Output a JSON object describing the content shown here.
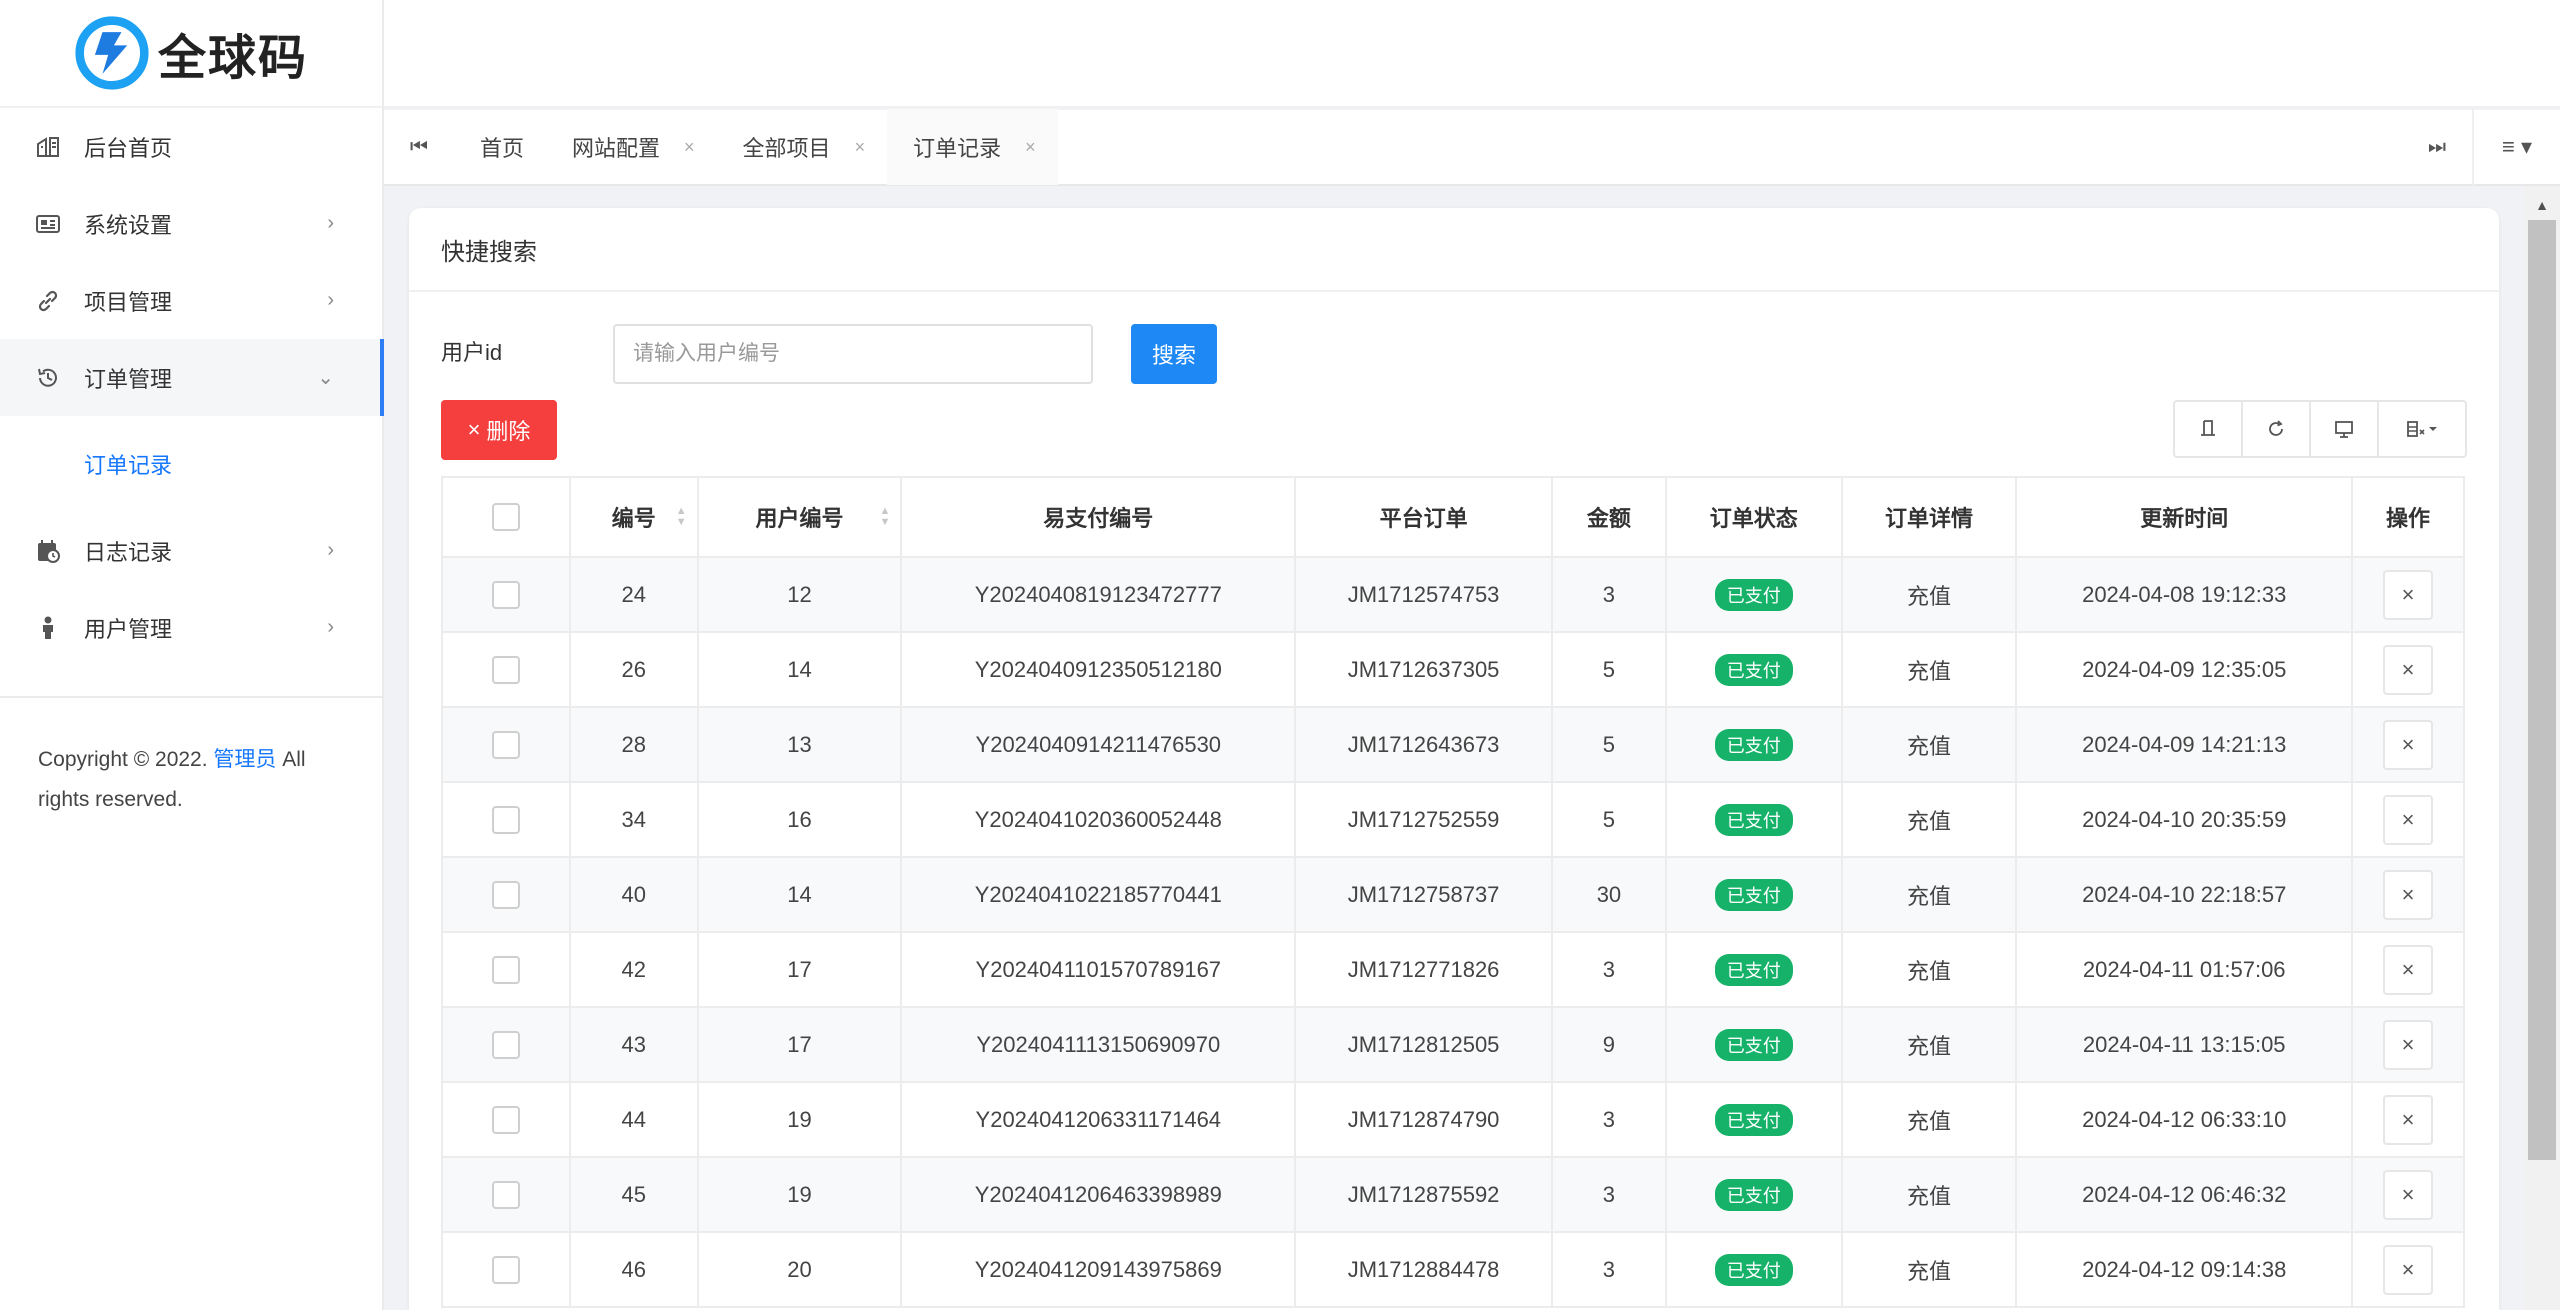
{
  "brand": {
    "name": "全球码",
    "accent": "#1677ff",
    "logo_colors": [
      "#1da1f2",
      "#1e7be0"
    ]
  },
  "sidebar": {
    "items": [
      {
        "label": "后台首页",
        "icon": "dashboard-icon",
        "has_arrow": false
      },
      {
        "label": "系统设置",
        "icon": "settings-card-icon",
        "has_arrow": true,
        "arrow": "›"
      },
      {
        "label": "项目管理",
        "icon": "link-icon",
        "has_arrow": true,
        "arrow": "›"
      },
      {
        "label": "订单管理",
        "icon": "history-icon",
        "has_arrow": true,
        "arrow": "⌄",
        "open": true
      },
      {
        "label": "日志记录",
        "icon": "calendar-check-icon",
        "has_arrow": true,
        "arrow": "›"
      },
      {
        "label": "用户管理",
        "icon": "person-icon",
        "has_arrow": true,
        "arrow": "›"
      }
    ],
    "submenu": {
      "label": "订单记录"
    },
    "copyright": {
      "prefix": "Copyright © 2022. ",
      "link": "管理员",
      "suffix_1": " All",
      "suffix_2": "rights reserved."
    }
  },
  "tabs": [
    {
      "label": "首页",
      "closable": false
    },
    {
      "label": "网站配置",
      "closable": true
    },
    {
      "label": "全部项目",
      "closable": true
    },
    {
      "label": "订单记录",
      "closable": true,
      "active": true
    }
  ],
  "tab_close_glyph": "×",
  "card": {
    "title": "快捷搜索",
    "search_label": "用户id",
    "search_placeholder": "请输入用户编号",
    "search_button": "搜索",
    "delete_button": "删除",
    "delete_glyph": "×"
  },
  "table": {
    "columns": [
      "编号",
      "用户编号",
      "易支付编号",
      "平台订单",
      "金额",
      "订单状态",
      "订单详情",
      "更新时间",
      "操作"
    ],
    "status_color": "#17b26a",
    "rows": [
      {
        "id": "24",
        "user": "12",
        "pay_no": "Y2024040819123472777",
        "order": "JM1712574753",
        "amount": "3",
        "status": "已支付",
        "detail": "充值",
        "time": "2024-04-08 19:12:33"
      },
      {
        "id": "26",
        "user": "14",
        "pay_no": "Y2024040912350512180",
        "order": "JM1712637305",
        "amount": "5",
        "status": "已支付",
        "detail": "充值",
        "time": "2024-04-09 12:35:05"
      },
      {
        "id": "28",
        "user": "13",
        "pay_no": "Y2024040914211476530",
        "order": "JM1712643673",
        "amount": "5",
        "status": "已支付",
        "detail": "充值",
        "time": "2024-04-09 14:21:13"
      },
      {
        "id": "34",
        "user": "16",
        "pay_no": "Y2024041020360052448",
        "order": "JM1712752559",
        "amount": "5",
        "status": "已支付",
        "detail": "充值",
        "time": "2024-04-10 20:35:59"
      },
      {
        "id": "40",
        "user": "14",
        "pay_no": "Y2024041022185770441",
        "order": "JM1712758737",
        "amount": "30",
        "status": "已支付",
        "detail": "充值",
        "time": "2024-04-10 22:18:57"
      },
      {
        "id": "42",
        "user": "17",
        "pay_no": "Y2024041101570789167",
        "order": "JM1712771826",
        "amount": "3",
        "status": "已支付",
        "detail": "充值",
        "time": "2024-04-11 01:57:06"
      },
      {
        "id": "43",
        "user": "17",
        "pay_no": "Y2024041113150690970",
        "order": "JM1712812505",
        "amount": "9",
        "status": "已支付",
        "detail": "充值",
        "time": "2024-04-11 13:15:05"
      },
      {
        "id": "44",
        "user": "19",
        "pay_no": "Y2024041206331171464",
        "order": "JM1712874790",
        "amount": "3",
        "status": "已支付",
        "detail": "充值",
        "time": "2024-04-12 06:33:10"
      },
      {
        "id": "45",
        "user": "19",
        "pay_no": "Y2024041206463398989",
        "order": "JM1712875592",
        "amount": "3",
        "status": "已支付",
        "detail": "充值",
        "time": "2024-04-12 06:46:32"
      },
      {
        "id": "46",
        "user": "20",
        "pay_no": "Y2024041209143975869",
        "order": "JM1712884478",
        "amount": "3",
        "status": "已支付",
        "detail": "充值",
        "time": "2024-04-12 09:14:38"
      }
    ],
    "row_action_glyph": "×"
  },
  "toolbar_icons": [
    "print-icon",
    "refresh-icon",
    "export-icon",
    "columns-icon"
  ]
}
